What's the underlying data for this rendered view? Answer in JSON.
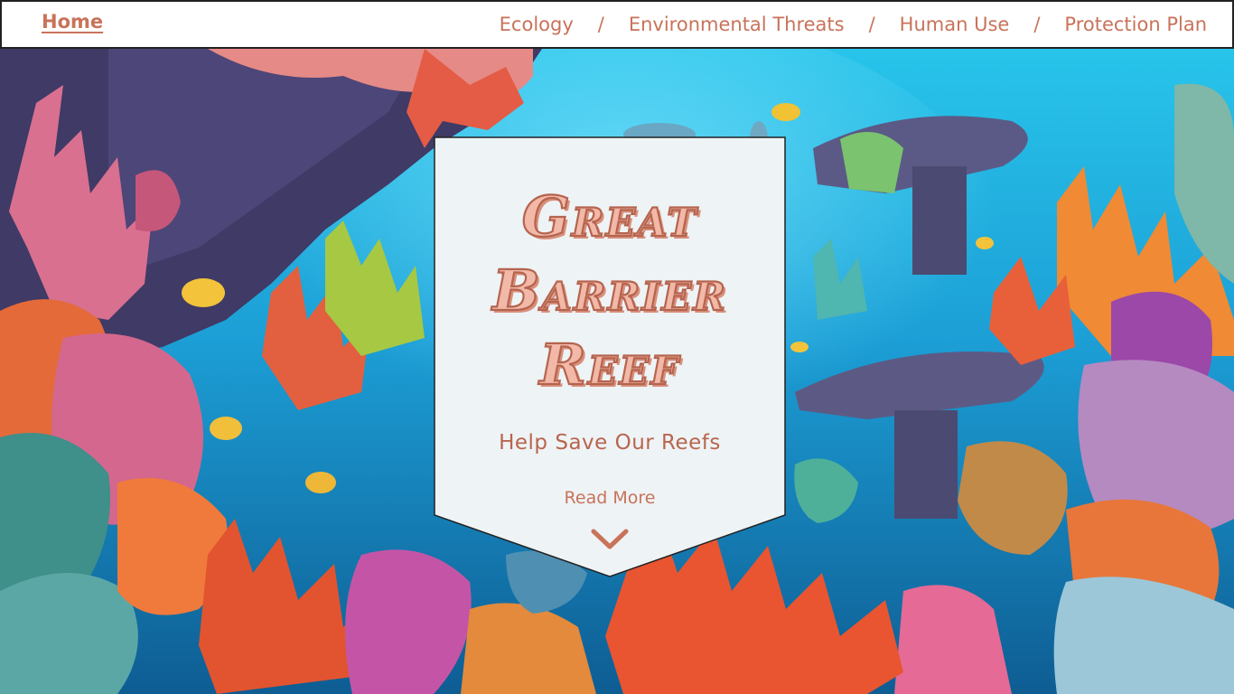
{
  "nav": {
    "home": "Home",
    "links": [
      "Ecology",
      "Environmental Threats",
      "Human Use",
      "Protection Plan"
    ],
    "separator": "/"
  },
  "hero": {
    "title_line1": "Great",
    "title_line2": "Barrier",
    "title_line3": "Reef",
    "subtitle": "Help Save Our Reefs",
    "read_more": "Read More",
    "scroll_icon": "chevron-down-icon"
  },
  "colors": {
    "accent": "#c8735a",
    "title_fill": "#f2b8a8",
    "card_bg": "#eef3f5",
    "nav_bg": "#ffffff",
    "water": "#2bb3e0"
  }
}
